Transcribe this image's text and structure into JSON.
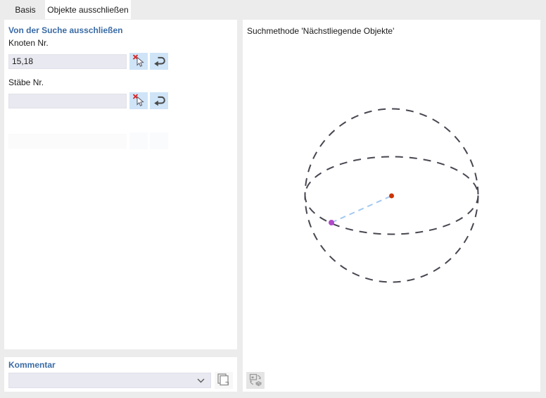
{
  "tabs": [
    {
      "label": "Basis",
      "active": false
    },
    {
      "label": "Objekte ausschließen",
      "active": true
    }
  ],
  "left_panel": {
    "section_title": "Von der Suche ausschließen",
    "knoten": {
      "label": "Knoten Nr.",
      "value": "15,18"
    },
    "staebe": {
      "label": "Stäbe Nr.",
      "value": ""
    },
    "disabled_row": {
      "label": "",
      "value": ""
    }
  },
  "comment_panel": {
    "title": "Kommentar",
    "value": ""
  },
  "right_panel": {
    "title": "Suchmethode 'Nächstliegende Objekte'"
  },
  "icons": {
    "pick": "pick-cursor-with-red-x-icon",
    "undo": "u-turn-left-arrow-icon",
    "chevron": "chevron-down-icon",
    "copy": "stacked-sheets-icon",
    "apply_graphic": "refresh-graphic-icon"
  },
  "colors": {
    "section_title_blue": "#3a6ba5",
    "input_background": "#e9e9f1",
    "button_background": "#cfe4f7",
    "sphere_stroke": "#474751",
    "search_line": "#a3c9ef",
    "center_node_dot": "#cc3300",
    "nearest_node_dot": "#b149c9",
    "window_background": "#ececec"
  }
}
